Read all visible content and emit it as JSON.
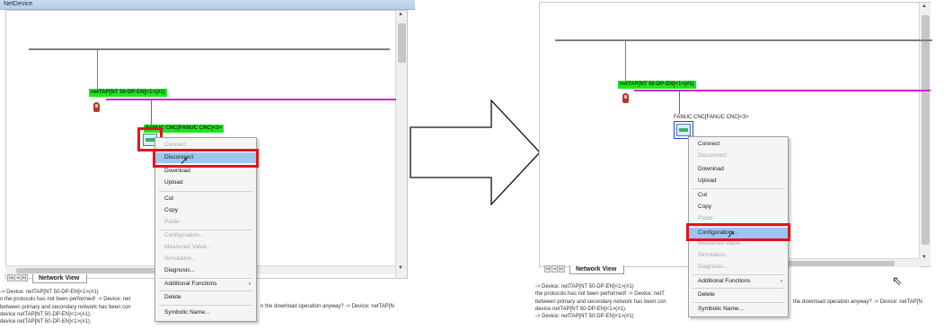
{
  "left": {
    "window_title": "NetDevice",
    "tab_label": "Network View",
    "nav_buttons": [
      "|◂",
      "◂",
      "▸|"
    ],
    "nettap_label": "netTAP[NT 50-DP-EN]<1>(#1)",
    "fanuc_label": "FANUC CNC[FANUC CNC]<3>",
    "menu": [
      {
        "label": "Connect",
        "state": "disabled"
      },
      {
        "label": "Disconnect",
        "state": "highlighted"
      },
      {
        "label": "Download",
        "state": "normal"
      },
      {
        "label": "Upload",
        "state": "normal"
      },
      {
        "label": "Cut",
        "state": "normal"
      },
      {
        "label": "Copy",
        "state": "normal"
      },
      {
        "label": "Paste",
        "state": "disabled"
      },
      {
        "label": "Configuration...",
        "state": "disabled"
      },
      {
        "label": "Measured Value...",
        "state": "disabled"
      },
      {
        "label": "Simulation...",
        "state": "disabled"
      },
      {
        "label": "Diagnosis...",
        "state": "normal"
      },
      {
        "label": "Additional Functions",
        "state": "submenu"
      },
      {
        "label": "Delete",
        "state": "normal"
      },
      {
        "label": "Symbolic Name...",
        "state": "normal"
      }
    ],
    "log": [
      "-> Device: netTAP[NT 50-DP-EN]<1>(#1)",
      "n the protocols has not been performed! -> Device: net",
      "between primary and secondary network has been con",
      "device netTAP[NT 50-DP-EN]<1>(#1).",
      "device netTAP[NT 50-DP-EN]<1>(#1)."
    ],
    "log_tail": "n the download operation anyway? -> Device: netTAP[N"
  },
  "right": {
    "tab_label": "Network View",
    "nav_buttons": [
      "|◂",
      "◂",
      "▸|"
    ],
    "nettap_label": "netTAP[NT 50-DP-EN]<1>(#1)",
    "fanuc_label": "FANUC CNC[FANUC CNC]<3>",
    "menu": [
      {
        "label": "Connect",
        "state": "normal"
      },
      {
        "label": "Disconnect",
        "state": "disabled"
      },
      {
        "label": "Download",
        "state": "normal"
      },
      {
        "label": "Upload",
        "state": "normal"
      },
      {
        "label": "Cut",
        "state": "normal"
      },
      {
        "label": "Copy",
        "state": "normal"
      },
      {
        "label": "Paste",
        "state": "disabled"
      },
      {
        "label": "Configuration...",
        "state": "highlighted"
      },
      {
        "label": "Measured Value...",
        "state": "disabled"
      },
      {
        "label": "Simulation...",
        "state": "disabled"
      },
      {
        "label": "Diagnosis...",
        "state": "disabled"
      },
      {
        "label": "Additional Functions",
        "state": "submenu"
      },
      {
        "label": "Delete",
        "state": "normal"
      },
      {
        "label": "Symbolic Name...",
        "state": "normal"
      }
    ],
    "log": [
      "-> Device: netTAP[NT 50-DP-EN]<1>(#1)",
      "the protocols has not been performed! -> Device: netT",
      "between primary and secondary network has been con",
      "device netTAP[NT 50-DP-EN]<1>(#1).",
      "-> Device: netTAP[NT 50-DP-EN]<1>(#1)"
    ],
    "log_tail": "the download operation anyway? -> Device: netTAP[N"
  },
  "colors": {
    "highlight_box": "#e3151a",
    "menu_highlight": "#9cc6ef",
    "device_label": "#1ee61e",
    "profibus_line": "#d51fd5",
    "ethernet_bus": "#7d7d7d"
  },
  "icons": [
    "nettap-device-icon",
    "fanuc-device-icon",
    "mouse-cursor-icon",
    "right-arrow-icon",
    "submenu-arrow-icon"
  ]
}
